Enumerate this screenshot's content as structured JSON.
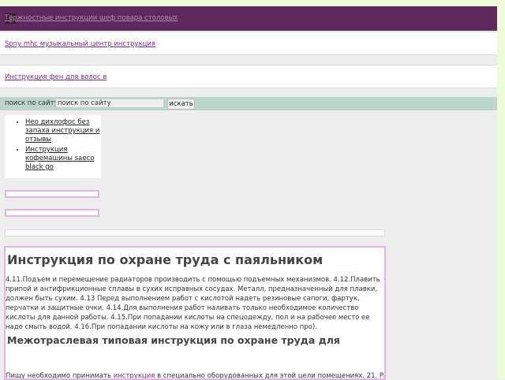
{
  "header": {
    "logo_letter": "П",
    "top_link": "Тержностные инструкции шеф повара столовых"
  },
  "nav": {
    "link1": "Sony mhc музыкальный центр инструкция",
    "link2": "Инструкция фен для волос в"
  },
  "search": {
    "label": "поиск по сайту",
    "value": "поиск по сайту",
    "button": "искать"
  },
  "sidebar": {
    "items": [
      {
        "label": "Нео дихлофос без запаха инструкция и отзывы"
      },
      {
        "label": "Инструкция кофемашины saeco black go"
      }
    ]
  },
  "article": {
    "title": "Инструкция по охране труда с паяльником",
    "paragraph1": "4.11.Подъем и перемещение радиаторов производить с помощью подъемных механизмов. 4.12.Плавить припой и антифрикционные сплавы в сухих исправных сосудах. Металл, предназначенный для плавки, должен быть сухим. 4.13 Перед выполнением работ с кислотой надеть  резиновые сапоги, фартук, перчатки и защитные очки. 4.14.Для выполнения работ наливать только необходимое количество кислоты для данной работы. 4.15.При попадании кислоты на спецодежду,  пол и на рабочее место ее надо смыть водой. 4.16.При попадании кислоты на кожу или в глаза немедленно про).",
    "subtitle": "Межотраслевая типовая инструкция по охране труда для",
    "p2_before": "Пищу необходимо принимать ",
    "p2_link": "инструкция",
    "p2_after": " в специально оборудованных для этой цели помещениях. 21. Работнику,"
  }
}
